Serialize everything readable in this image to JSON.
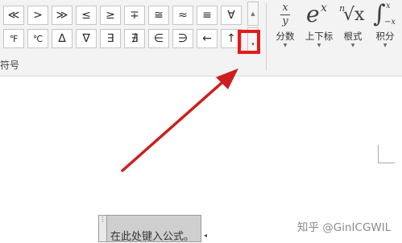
{
  "symbols": {
    "row1": [
      "≪",
      ">",
      "≫",
      "≤",
      "≥",
      "∓",
      "≅",
      "≈",
      "≡",
      "∀"
    ],
    "row2": [
      "℉",
      "℃",
      "∆",
      "∇",
      "∃",
      "∄",
      "∈",
      "∋",
      "←",
      "↑"
    ],
    "group_label": "符号",
    "scroll_up_glyph": "▲",
    "more_glyph": "▾"
  },
  "structures": [
    {
      "name": "fraction",
      "icon_top": "x",
      "icon_bottom": "y",
      "label": "分数",
      "caret": "▼"
    },
    {
      "name": "script",
      "icon_base": "e",
      "icon_sup": "x",
      "label": "上下标",
      "caret": "▼"
    },
    {
      "name": "radical",
      "icon_index": "n",
      "icon_body": "√x",
      "label": "根式",
      "caret": "▼"
    },
    {
      "name": "integral",
      "icon_sup": "x",
      "icon_body": "∫",
      "icon_sub": "−x",
      "label": "积分",
      "caret": "▼"
    }
  ],
  "equation": {
    "placeholder": "在此处键入公式。",
    "handle_glyph": "⋮",
    "arrow_glyph": "◂"
  },
  "watermark": "知乎 @GinICGWIL",
  "colors": {
    "highlight": "#e61a1a",
    "arrow": "#cc1f1f",
    "ribbon_bg": "#f3f3f3"
  }
}
